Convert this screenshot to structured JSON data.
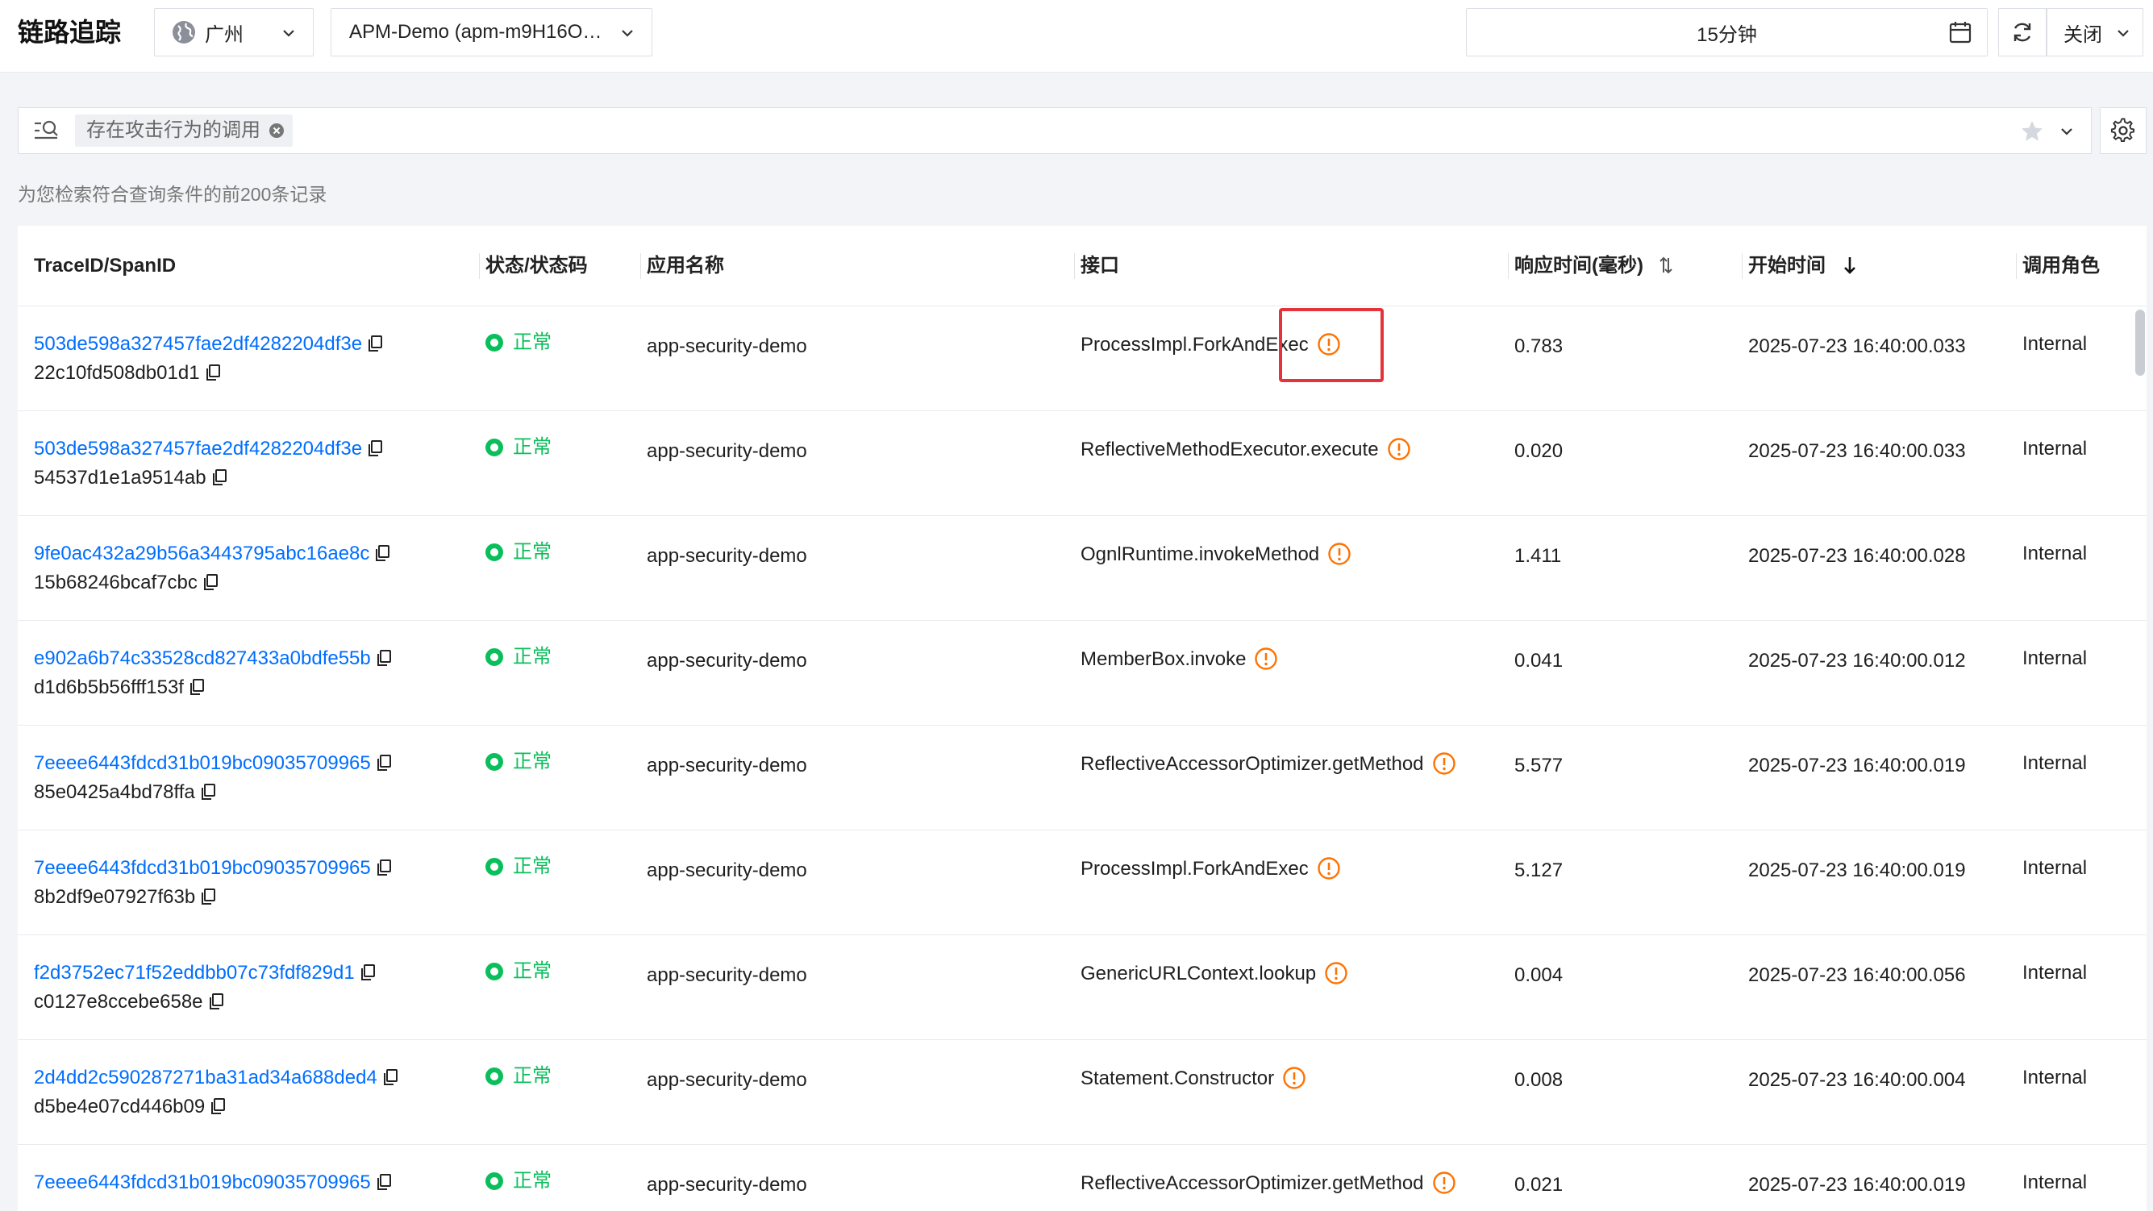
{
  "header": {
    "title": "链路追踪",
    "region": "广州",
    "app": "APM-Demo (apm-m9H16O…",
    "time_range": "15分钟",
    "auto_refresh": "关闭"
  },
  "search": {
    "filter_chip": "存在攻击行为的调用"
  },
  "summary": "为您检索符合查询条件的前200条记录",
  "table": {
    "columns": {
      "trace": "TraceID/SpanID",
      "status": "状态/状态码",
      "app": "应用名称",
      "interface": "接口",
      "duration": "响应时间(毫秒)",
      "start": "开始时间",
      "role": "调用角色"
    },
    "rows": [
      {
        "trace_id": "503de598a327457fae2df4282204df3e",
        "span_id": "22c10fd508db01d1",
        "status": "正常",
        "app": "app-security-demo",
        "interface": "ProcessImpl.ForkAndExec",
        "duration": "0.783",
        "start": "2025-07-23 16:40:00.033",
        "role": "Internal"
      },
      {
        "trace_id": "503de598a327457fae2df4282204df3e",
        "span_id": "54537d1e1a9514ab",
        "status": "正常",
        "app": "app-security-demo",
        "interface": "ReflectiveMethodExecutor.execute",
        "duration": "0.020",
        "start": "2025-07-23 16:40:00.033",
        "role": "Internal"
      },
      {
        "trace_id": "9fe0ac432a29b56a3443795abc16ae8c",
        "span_id": "15b68246bcaf7cbc",
        "status": "正常",
        "app": "app-security-demo",
        "interface": "OgnlRuntime.invokeMethod",
        "duration": "1.411",
        "start": "2025-07-23 16:40:00.028",
        "role": "Internal"
      },
      {
        "trace_id": "e902a6b74c33528cd827433a0bdfe55b",
        "span_id": "d1d6b5b56fff153f",
        "status": "正常",
        "app": "app-security-demo",
        "interface": "MemberBox.invoke",
        "duration": "0.041",
        "start": "2025-07-23 16:40:00.012",
        "role": "Internal"
      },
      {
        "trace_id": "7eeee6443fdcd31b019bc09035709965",
        "span_id": "85e0425a4bd78ffa",
        "status": "正常",
        "app": "app-security-demo",
        "interface": "ReflectiveAccessorOptimizer.getMethod",
        "duration": "5.577",
        "start": "2025-07-23 16:40:00.019",
        "role": "Internal"
      },
      {
        "trace_id": "7eeee6443fdcd31b019bc09035709965",
        "span_id": "8b2df9e07927f63b",
        "status": "正常",
        "app": "app-security-demo",
        "interface": "ProcessImpl.ForkAndExec",
        "duration": "5.127",
        "start": "2025-07-23 16:40:00.019",
        "role": "Internal"
      },
      {
        "trace_id": "f2d3752ec71f52eddbb07c73fdf829d1",
        "span_id": "c0127e8ccebe658e",
        "status": "正常",
        "app": "app-security-demo",
        "interface": "GenericURLContext.lookup",
        "duration": "0.004",
        "start": "2025-07-23 16:40:00.056",
        "role": "Internal"
      },
      {
        "trace_id": "2d4dd2c590287271ba31ad34a688ded4",
        "span_id": "d5be4e07cd446b09",
        "status": "正常",
        "app": "app-security-demo",
        "interface": "Statement.Constructor",
        "duration": "0.008",
        "start": "2025-07-23 16:40:00.004",
        "role": "Internal"
      },
      {
        "trace_id": "7eeee6443fdcd31b019bc09035709965",
        "span_id": "",
        "status": "正常",
        "app": "app-security-demo",
        "interface": "ReflectiveAccessorOptimizer.getMethod",
        "duration": "0.021",
        "start": "2025-07-23 16:40:00.019",
        "role": "Internal"
      }
    ]
  },
  "colors": {
    "link": "#006eff",
    "success": "#0abf5b",
    "warning": "#ff7200",
    "highlight": "#e5333a"
  },
  "icons": {
    "region": "globe-icon",
    "time": "calendar-icon",
    "refresh": "refresh-icon",
    "filter": "filter-search-icon",
    "favorite": "star-icon",
    "settings": "gear-icon",
    "copy": "copy-icon",
    "risk": "warning-circle-icon"
  }
}
